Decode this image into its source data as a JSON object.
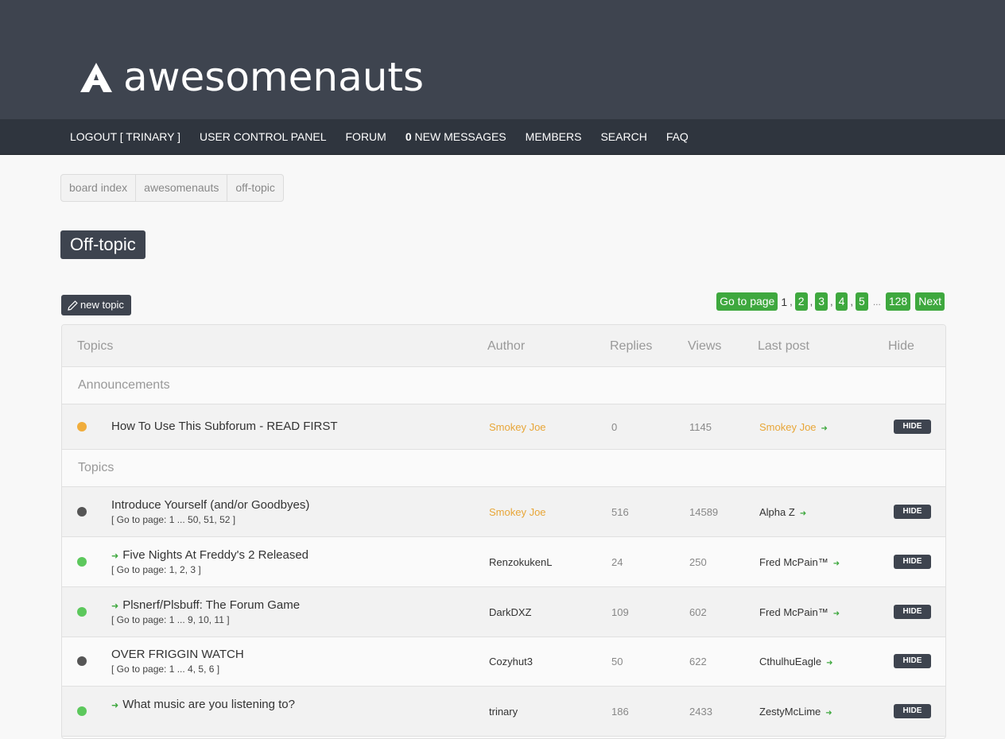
{
  "header": {
    "logo_text": "awesomenauts"
  },
  "nav": {
    "logout": "LOGOUT [ TRINARY ]",
    "ucp": "USER CONTROL PANEL",
    "forum": "FORUM",
    "messages_count": "0",
    "messages_label": " NEW MESSAGES",
    "members": "MEMBERS",
    "search": "SEARCH",
    "faq": "FAQ"
  },
  "breadcrumb": [
    "board index",
    "awesomenauts",
    "off-topic"
  ],
  "page_title": "Off-topic",
  "new_topic_label": "new topic",
  "pagination": {
    "goto": "Go to page",
    "current": "1",
    "pages": [
      "2",
      "3",
      "4",
      "5"
    ],
    "ellipsis": "...",
    "last": "128",
    "next": "Next"
  },
  "table": {
    "headers": {
      "topics": "Topics",
      "author": "Author",
      "replies": "Replies",
      "views": "Views",
      "last_post": "Last post",
      "hide": "Hide"
    },
    "announcements_label": "Announcements",
    "topics_label": "Topics",
    "hide_label": "HIDE",
    "announcement": {
      "title": "How To Use This Subforum - READ FIRST",
      "author": "Smokey Joe",
      "replies": "0",
      "views": "1145",
      "last_post": "Smokey Joe",
      "status_color": "#f0ad3c"
    },
    "rows": [
      {
        "title": "Introduce Yourself (and/or Goodbyes)",
        "pages": "[ Go to page: 1 ... 50, 51, 52 ]",
        "author": "Smokey Joe",
        "replies": "516",
        "views": "14589",
        "last_post": "Alpha Z",
        "status_color": "#555555"
      },
      {
        "title": "Five Nights At Freddy's 2 Released",
        "pages": "[ Go to page: 1, 2, 3 ]",
        "author": "RenzokukenL",
        "replies": "24",
        "views": "250",
        "last_post": "Fred McPain™",
        "status_color": "#5cc85c"
      },
      {
        "title": "Plsnerf/Plsbuff: The Forum Game",
        "pages": "[ Go to page: 1 ... 9, 10, 11 ]",
        "author": "DarkDXZ",
        "replies": "109",
        "views": "602",
        "last_post": "Fred McPain™",
        "status_color": "#5cc85c"
      },
      {
        "title": "OVER FRIGGIN WATCH",
        "pages": "[ Go to page: 1 ... 4, 5, 6 ]",
        "author": "Cozyhut3",
        "replies": "50",
        "views": "622",
        "last_post": "CthulhuEagle",
        "status_color": "#555555"
      },
      {
        "title": "What music are you listening to?",
        "pages": "",
        "author": "trinary",
        "replies": "186",
        "views": "2433",
        "last_post": "ZestyMcLime",
        "status_color": "#5cc85c"
      }
    ]
  },
  "colors": {
    "header_bg": "#3e444f",
    "nav_bg": "#2f353e",
    "accent_green": "#3ea83e",
    "author_orange": "#e8a638"
  }
}
